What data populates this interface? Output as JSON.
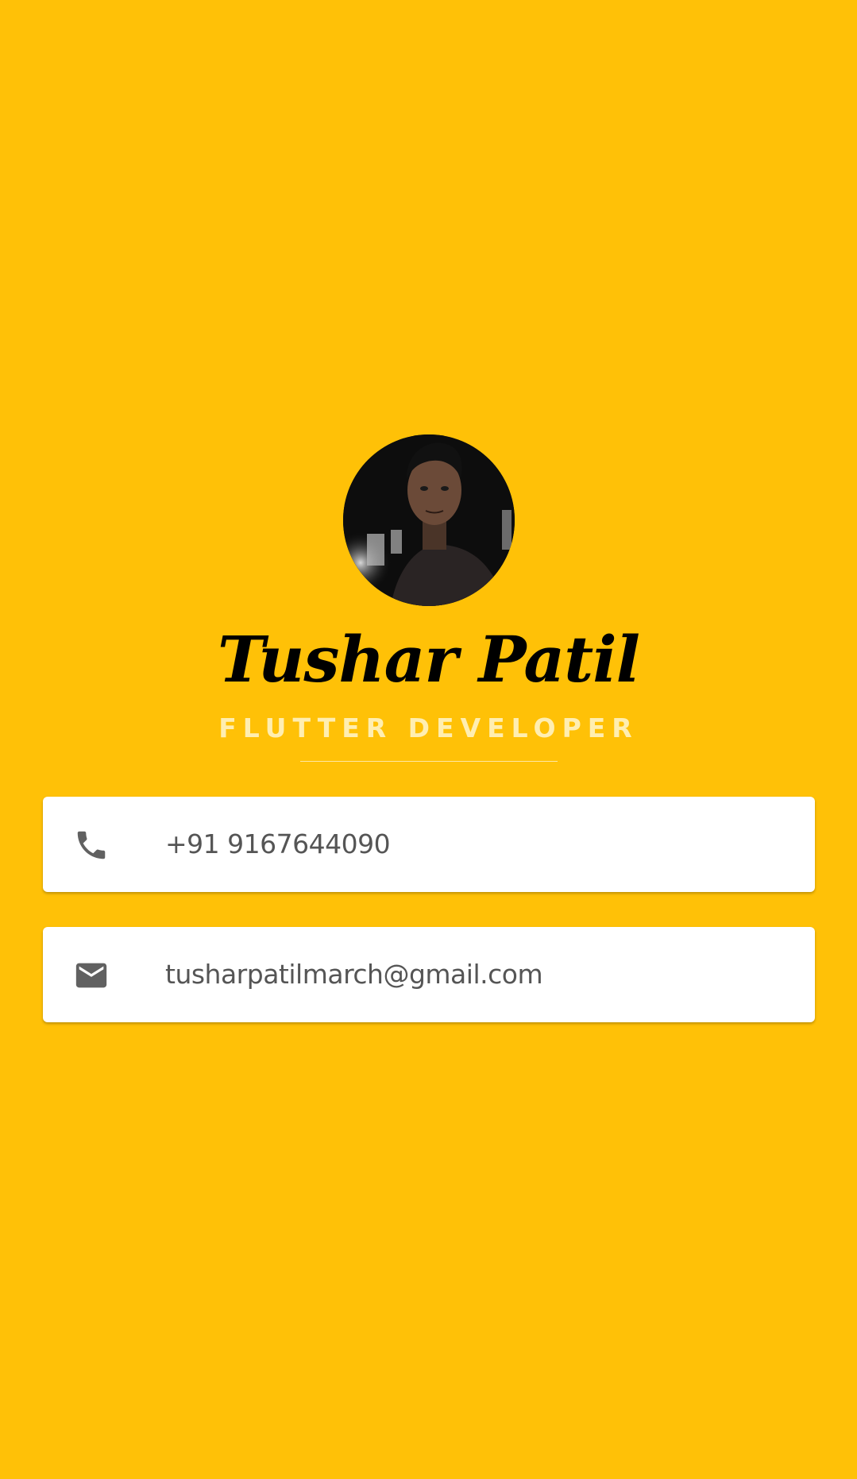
{
  "profile": {
    "name": "Tushar Patil",
    "title": "FLUTTER DEVELOPER",
    "avatar_alt": "profile-photo"
  },
  "contacts": {
    "phone": {
      "icon": "phone-icon",
      "value": "+91 9167644090"
    },
    "email": {
      "icon": "mail-icon",
      "value": "tusharpatilmarch@gmail.com"
    }
  },
  "colors": {
    "background": "#FFC107",
    "card": "#FFFFFF",
    "icon": "#616161",
    "text": "#555555",
    "title": "#FFF3C4"
  }
}
